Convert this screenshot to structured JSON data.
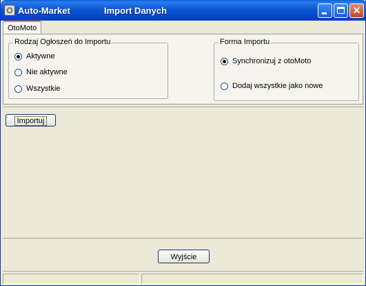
{
  "window": {
    "app_name": "Auto-Market",
    "title": "Import Danych",
    "controls": [
      "minimize-icon",
      "maximize-icon",
      "close-icon"
    ],
    "close_glyph": "✕"
  },
  "tabs": [
    {
      "label": "OtoMoto",
      "active": true
    }
  ],
  "ad_type_group": {
    "legend": "Rodzaj Ogłoszeń do Importu",
    "options": [
      {
        "label": "Aktywne",
        "checked": true
      },
      {
        "label": "Nie aktywne",
        "checked": false
      },
      {
        "label": "Wszystkie",
        "checked": false
      }
    ]
  },
  "import_mode_group": {
    "legend": "Forma Importu",
    "options": [
      {
        "label": "Synchronizuj z otoMoto",
        "checked": true
      },
      {
        "label": "Dodaj wszystkie jako nowe",
        "checked": false
      }
    ]
  },
  "buttons": {
    "import_label": "Importuj",
    "exit_label": "Wyjście"
  },
  "colors": {
    "titlebar": "#0343c8",
    "window_bg": "#ece9d8",
    "tab_accent": "#e68b2c"
  }
}
